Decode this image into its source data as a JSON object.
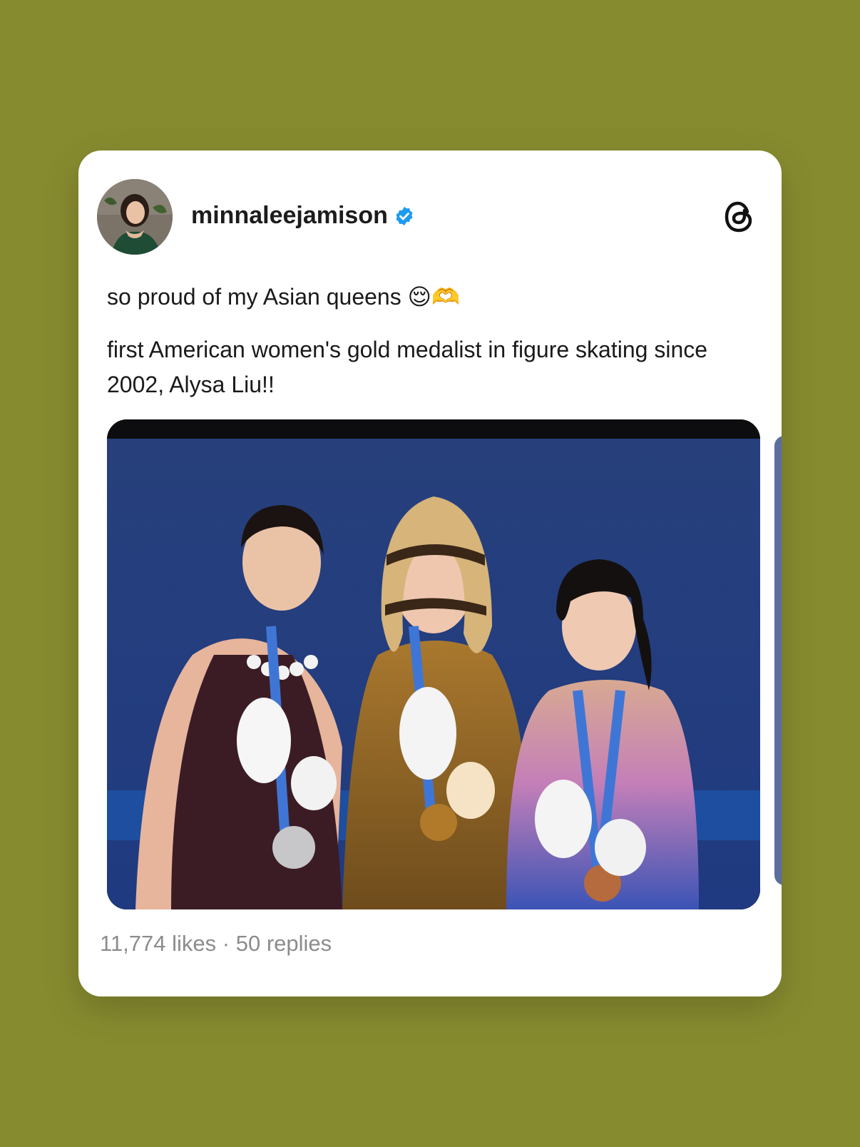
{
  "post": {
    "username": "minnaleejamison",
    "caption_line1": "so proud of my Asian queens 😌🫶",
    "caption_line2": "first American women's gold medalist in figure skating since 2002, Alysa Liu!!",
    "likes": "11,774 likes",
    "separator": "·",
    "replies": "50 replies"
  },
  "icons": {
    "verified": "verified-badge-icon",
    "threads": "threads-logo-icon"
  },
  "colors": {
    "background": "#878b2f",
    "card": "#ffffff",
    "verified": "#1d9bf0",
    "meta_text": "#8c8c8c"
  }
}
